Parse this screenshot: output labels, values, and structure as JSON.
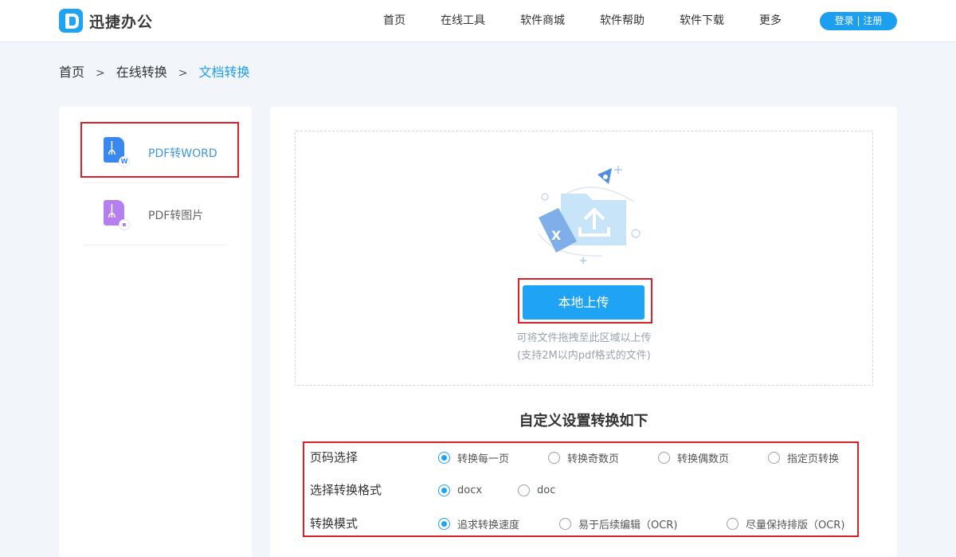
{
  "header": {
    "logo_text": "迅捷办公",
    "nav": [
      "首页",
      "在线工具",
      "软件商城",
      "软件帮助",
      "软件下载",
      "更多"
    ],
    "login_label": "登录 | 注册"
  },
  "breadcrumb": {
    "items": [
      "首页",
      "在线转换",
      "文档转换"
    ],
    "separator": ">"
  },
  "sidebar": {
    "items": [
      {
        "label": "PDF转WORD",
        "icon": "pdf-to-word-icon",
        "selected": true
      },
      {
        "label": "PDF转图片",
        "icon": "pdf-to-image-icon",
        "selected": false
      }
    ]
  },
  "upload": {
    "button_label": "本地上传",
    "hint_drag": "可将文件拖拽至此区域以上传",
    "hint_limit": "(支持2M以内pdf格式的文件)"
  },
  "settings": {
    "title": "自定义设置转换如下",
    "rows": [
      {
        "label": "页码选择",
        "options": [
          "转换每一页",
          "转换奇数页",
          "转换偶数页",
          "指定页转换"
        ],
        "selected": 0
      },
      {
        "label": "选择转换格式",
        "options": [
          "docx",
          "doc"
        ],
        "selected": 0
      },
      {
        "label": "转换模式",
        "options": [
          "追求转换速度",
          "易于后续编辑（OCR)",
          "尽量保持排版（OCR)"
        ],
        "selected": 0
      }
    ]
  },
  "colors": {
    "accent": "#1fa3f5",
    "highlight_border": "#d9212c",
    "breadcrumb_current": "#1f9fec"
  }
}
